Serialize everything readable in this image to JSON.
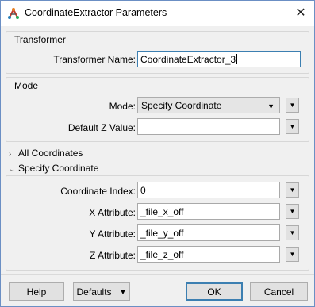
{
  "window": {
    "title": "CoordinateExtractor Parameters",
    "app_icon": "fme-transformer-icon",
    "close_glyph": "✕"
  },
  "transformer_group": {
    "title": "Transformer",
    "name_label": "Transformer Name:",
    "name_value": "CoordinateExtractor_3"
  },
  "mode_group": {
    "title": "Mode",
    "mode_label": "Mode:",
    "mode_value": "Specify Coordinate",
    "default_z_label": "Default Z Value:",
    "default_z_value": ""
  },
  "all_coordinates": {
    "label": "All Coordinates",
    "expanded": false
  },
  "specify_coordinate": {
    "label": "Specify Coordinate",
    "expanded": true,
    "index_label": "Coordinate Index:",
    "index_value": "0",
    "x_label": "X Attribute:",
    "x_value": "_file_x_off",
    "y_label": "Y Attribute:",
    "y_value": "_file_y_off",
    "z_label": "Z Attribute:",
    "z_value": "_file_z_off"
  },
  "footer": {
    "help": "Help",
    "defaults": "Defaults",
    "ok": "OK",
    "cancel": "Cancel"
  },
  "glyphs": {
    "dropdown": "▼",
    "collapsed": "›",
    "expanded": "⌄"
  }
}
